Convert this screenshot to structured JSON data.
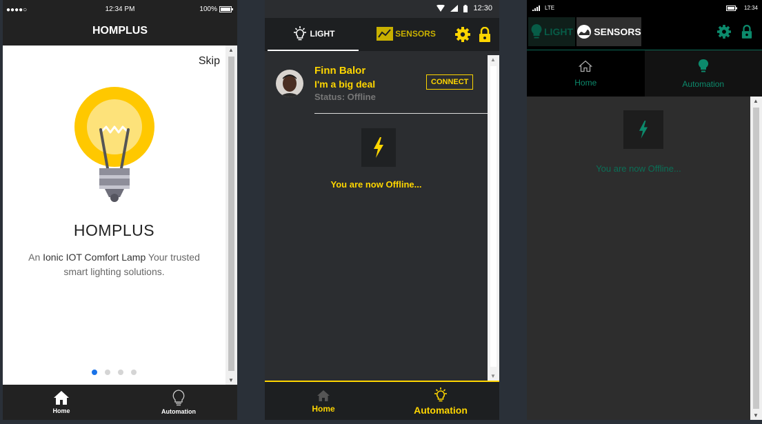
{
  "colors": {
    "ios_accent": "#1a73e8",
    "android_accent": "#ffd600",
    "windows_accent": "#0c8a6c"
  },
  "ios": {
    "status": {
      "signal": "●●●●○",
      "time": "12:34 PM",
      "battery": "100%"
    },
    "title": "HOMPLUS",
    "skip": "Skip",
    "app_name": "HOMPLUS",
    "desc_prefix": "An",
    "desc_bold": "Ionic IOT Comfort Lamp",
    "desc_suffix": "Your trusted smart lighting solutions.",
    "tabs": [
      {
        "label": "Home",
        "icon": "home-icon"
      },
      {
        "label": "Automation",
        "icon": "bulb-icon"
      }
    ]
  },
  "android": {
    "status": {
      "time": "12:30"
    },
    "tabs_top": [
      {
        "label": "LIGHT",
        "icon": "bulb-icon"
      },
      {
        "label": "SENSORS",
        "icon": "chart-icon"
      }
    ],
    "profile": {
      "name": "Finn Balor",
      "tagline": "I'm a big deal",
      "status": "Status: Offline"
    },
    "connect_label": "CONNECT",
    "offline_message": "You are now Offline...",
    "tabs": [
      {
        "label": "Home",
        "icon": "home-icon"
      },
      {
        "label": "Automation",
        "icon": "bulb-icon"
      }
    ]
  },
  "windows": {
    "status": {
      "network": "LTE",
      "time": "12:34"
    },
    "tabs_top": [
      {
        "label": "LIGHT",
        "icon": "bulb-icon"
      },
      {
        "label": "SENSORS",
        "icon": "gauge-icon"
      }
    ],
    "tabs": [
      {
        "label": "Home",
        "icon": "home-icon"
      },
      {
        "label": "Automation",
        "icon": "bulb-icon"
      }
    ],
    "offline_message": "You are now Offline..."
  }
}
